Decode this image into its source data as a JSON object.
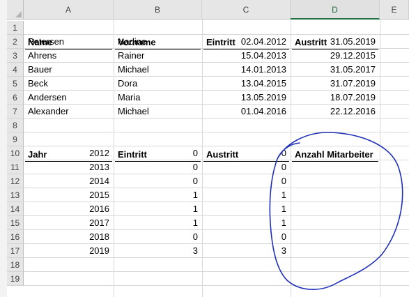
{
  "columns": [
    "A",
    "B",
    "C",
    "D",
    "E"
  ],
  "rows": [
    "1",
    "2",
    "3",
    "4",
    "5",
    "6",
    "7",
    "8",
    "9",
    "10",
    "11",
    "12",
    "13",
    "14",
    "15",
    "16",
    "17",
    "18",
    "19"
  ],
  "header1": {
    "name": "Name",
    "vorname": "Vorname",
    "eintritt": "Eintritt",
    "austritt": "Austritt"
  },
  "employees": [
    {
      "name": "Petersen",
      "vorname": "Nadine",
      "eintritt": "02.04.2012",
      "austritt": "31.05.2019"
    },
    {
      "name": "Ahrens",
      "vorname": "Rainer",
      "eintritt": "15.04.2013",
      "austritt": "29.12.2015"
    },
    {
      "name": "Bauer",
      "vorname": "Michael",
      "eintritt": "14.01.2013",
      "austritt": "31.05.2017"
    },
    {
      "name": "Beck",
      "vorname": "Dora",
      "eintritt": "13.04.2015",
      "austritt": "31.07.2019"
    },
    {
      "name": "Andersen",
      "vorname": "Maria",
      "eintritt": "13.05.2019",
      "austritt": "18.07.2019"
    },
    {
      "name": "Alexander",
      "vorname": "Michael",
      "eintritt": "01.04.2016",
      "austritt": "22.12.2016"
    }
  ],
  "header2": {
    "jahr": "Jahr",
    "eintritt": "Eintritt",
    "austritt": "Austritt",
    "anzahl": "Anzahl Mitarbeiter"
  },
  "years": [
    {
      "jahr": "2012",
      "eintritt": "0",
      "austritt": "0"
    },
    {
      "jahr": "2013",
      "eintritt": "0",
      "austritt": "0"
    },
    {
      "jahr": "2014",
      "eintritt": "0",
      "austritt": "0"
    },
    {
      "jahr": "2015",
      "eintritt": "1",
      "austritt": "1"
    },
    {
      "jahr": "2016",
      "eintritt": "1",
      "austritt": "1"
    },
    {
      "jahr": "2017",
      "eintritt": "1",
      "austritt": "1"
    },
    {
      "jahr": "2018",
      "eintritt": "0",
      "austritt": "0"
    },
    {
      "jahr": "2019",
      "eintritt": "3",
      "austritt": "3"
    }
  ],
  "selected_column": "D",
  "annotation_color": "#1f2fb8"
}
